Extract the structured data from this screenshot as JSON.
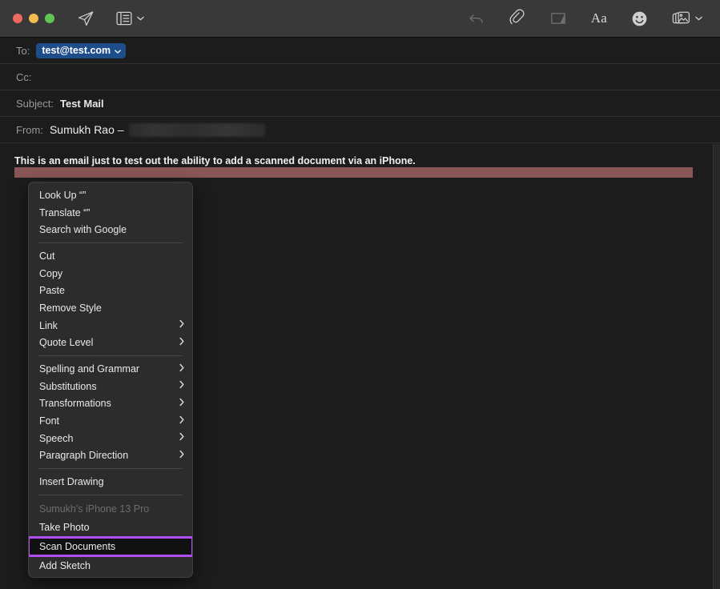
{
  "window": {
    "traffic_lights": [
      {
        "name": "close",
        "color": "#ec6a5f"
      },
      {
        "name": "minimize",
        "color": "#f4bd50"
      },
      {
        "name": "zoom",
        "color": "#61c555"
      }
    ]
  },
  "toolbar": {
    "left_items": [
      {
        "name": "send-icon",
        "label": "Send",
        "enabled": true
      },
      {
        "name": "header-fields-icon",
        "label": "Header Fields",
        "enabled": true,
        "caret": true
      }
    ],
    "right_items": [
      {
        "name": "undo-icon",
        "label": "Undo",
        "enabled": false
      },
      {
        "name": "attachment-icon",
        "label": "Attach File",
        "enabled": true
      },
      {
        "name": "markup-icon",
        "label": "Markup",
        "enabled": false
      },
      {
        "name": "format-icon",
        "label": "Aa",
        "text": "Aa",
        "enabled": true
      },
      {
        "name": "emoji-icon",
        "label": "Emoji & Symbols",
        "enabled": true
      },
      {
        "name": "photo-browser-icon",
        "label": "Photo Browser",
        "enabled": true,
        "caret": true
      }
    ]
  },
  "header_fields": [
    {
      "label": "To:",
      "value": "test@test.com",
      "type": "token"
    },
    {
      "label": "Cc:",
      "value": "",
      "type": "text"
    },
    {
      "label": "Subject:",
      "value": "Test Mail",
      "type": "subject"
    },
    {
      "label": "From:",
      "value": "Sumukh Rao –",
      "type": "from-redacted"
    }
  ],
  "body": {
    "text": "This is an email just to test out the ability to add a scanned document via an iPhone.",
    "selection_color": "#8a5757"
  },
  "context_menu": {
    "highlight_color": "#b14ef0",
    "groups": [
      {
        "items": [
          {
            "label": "Look Up “”",
            "name": "menu-item-look-up",
            "submenu": false
          },
          {
            "label": "Translate “”",
            "name": "menu-item-translate",
            "submenu": false
          },
          {
            "label": "Search with Google",
            "name": "menu-item-search-with-google",
            "submenu": false
          }
        ]
      },
      {
        "items": [
          {
            "label": "Cut",
            "name": "menu-item-cut",
            "submenu": false
          },
          {
            "label": "Copy",
            "name": "menu-item-copy",
            "submenu": false
          },
          {
            "label": "Paste",
            "name": "menu-item-paste",
            "submenu": false
          },
          {
            "label": "Remove Style",
            "name": "menu-item-remove-style",
            "submenu": false
          },
          {
            "label": "Link",
            "name": "menu-item-link",
            "submenu": true
          },
          {
            "label": "Quote Level",
            "name": "menu-item-quote-level",
            "submenu": true
          }
        ]
      },
      {
        "items": [
          {
            "label": "Spelling and Grammar",
            "name": "menu-item-spelling-and-grammar",
            "submenu": true
          },
          {
            "label": "Substitutions",
            "name": "menu-item-substitutions",
            "submenu": true
          },
          {
            "label": "Transformations",
            "name": "menu-item-transformations",
            "submenu": true
          },
          {
            "label": "Font",
            "name": "menu-item-font",
            "submenu": true
          },
          {
            "label": "Speech",
            "name": "menu-item-speech",
            "submenu": true
          },
          {
            "label": "Paragraph Direction",
            "name": "menu-item-paragraph-direction",
            "submenu": true
          }
        ]
      },
      {
        "items": [
          {
            "label": "Insert Drawing",
            "name": "menu-item-insert-drawing",
            "submenu": false
          }
        ]
      },
      {
        "items": [
          {
            "label": "Sumukh's iPhone 13 Pro",
            "name": "menu-section-header-iphone",
            "section_header": true
          },
          {
            "label": "Take Photo",
            "name": "menu-item-take-photo",
            "submenu": false
          },
          {
            "label": "Scan Documents",
            "name": "menu-item-scan-documents",
            "submenu": false,
            "highlighted": true
          },
          {
            "label": "Add Sketch",
            "name": "menu-item-add-sketch",
            "submenu": false
          }
        ]
      }
    ]
  }
}
